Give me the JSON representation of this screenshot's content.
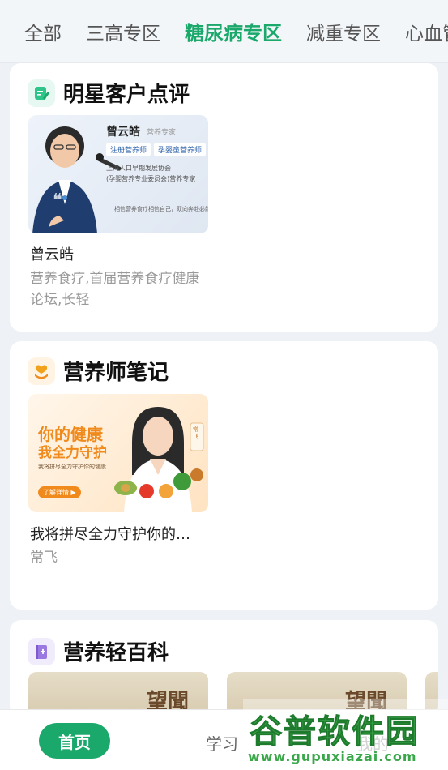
{
  "tabs": [
    "全部",
    "三高专区",
    "糖尿病专区",
    "减重专区",
    "心血管专区"
  ],
  "active_tab_index": 2,
  "sections": {
    "reviews": {
      "title": "明星客户点评",
      "item": {
        "thumb_name": "曾云皓",
        "thumb_role": "营养专家",
        "thumb_tag1": "注册营养师",
        "thumb_tag2": "孕婴童营养师",
        "thumb_org1": "上海人口早期发展协会",
        "thumb_org2": "(孕婴营养专业委员会)营养专家",
        "thumb_quote": "相信营养食疗相信自己，双向奔赴必能成",
        "name": "曾云皓",
        "desc": "营养食疗,首届营养食疗健康论坛,长轻"
      }
    },
    "notes": {
      "title": "营养师笔记",
      "item": {
        "banner_title1": "你的健康",
        "banner_title2": "我全力守护",
        "banner_sub": "我将拼尽全力守护你的健康",
        "banner_button": "了解详情 ▶",
        "banner_badge": "常飞",
        "title": "我将拼尽全力守护你的…",
        "author": "常飞"
      }
    },
    "encyclopedia": {
      "title": "营养轻百科",
      "thumb_text": "望聞"
    }
  },
  "bottom_nav": {
    "home": "首页",
    "learn": "学习",
    "mine": "我的"
  },
  "watermark": {
    "title": "谷普软件园",
    "url": "www.gupuxiazai.com"
  },
  "colors": {
    "accent": "#1aa86b",
    "orange": "#f08a1c"
  }
}
